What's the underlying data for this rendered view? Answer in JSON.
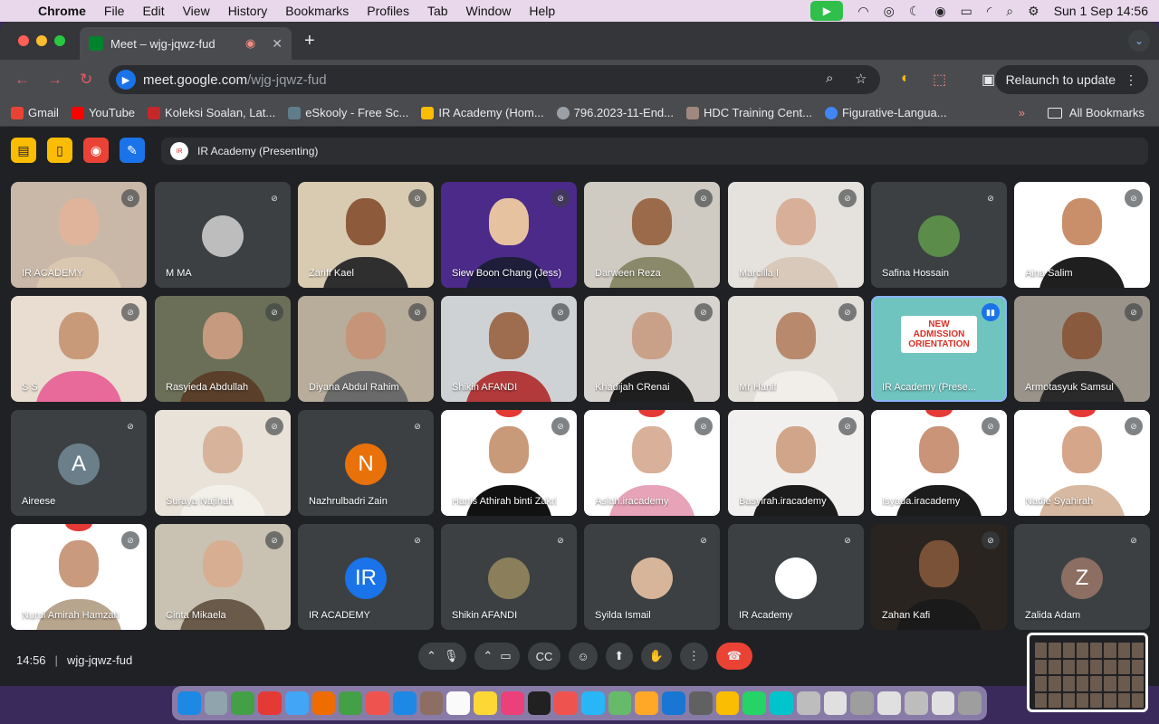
{
  "menubar": {
    "apple_glyph": "",
    "app": "Chrome",
    "items": [
      "File",
      "Edit",
      "View",
      "History",
      "Bookmarks",
      "Profiles",
      "Tab",
      "Window",
      "Help"
    ],
    "clock": "Sun 1 Sep  14:56"
  },
  "browser": {
    "tab_title": "Meet – wjg-jqwz-fud",
    "url_host": "meet.google.com",
    "url_path": "/wjg-jqwz-fud",
    "relaunch_label": "Relaunch to update",
    "bookmarks": [
      {
        "label": "Gmail",
        "color": "#ea4335"
      },
      {
        "label": "YouTube",
        "color": "#ff0000"
      },
      {
        "label": "Koleksi Soalan, Lat...",
        "color": "#c62828"
      },
      {
        "label": "eSkooly - Free Sc...",
        "color": "#607d8b"
      },
      {
        "label": "IR Academy (Hom...",
        "color": "#fbbc04"
      },
      {
        "label": "796.2023-11-End...",
        "color": "#9aa0a6"
      },
      {
        "label": "HDC Training Cent...",
        "color": "#a1887f"
      },
      {
        "label": "Figurative-Langua...",
        "color": "#4285f4"
      }
    ],
    "bookmarks_more": "»",
    "all_bookmarks": "All Bookmarks"
  },
  "meet": {
    "presenting_label": "IR Academy (Presenting)",
    "meeting_time": "14:56",
    "meeting_code": "wjg-jqwz-fud",
    "participants": [
      {
        "name": "IR ACADEMY",
        "kind": "video",
        "bg": "#c9b8a8",
        "skin": "#e0b49a",
        "cloth": "#d9c7b0"
      },
      {
        "name": "M MA",
        "kind": "avatar",
        "initial": "",
        "bg": "#3c4043",
        "avatar_color": "#bdbdbd"
      },
      {
        "name": "Zariff Kael",
        "kind": "video",
        "bg": "#d9cbb2",
        "skin": "#8d5a3b",
        "cloth": "#2f2f2f"
      },
      {
        "name": "Siew Boon Chang (Jess)",
        "kind": "video",
        "bg": "#4b2a8a",
        "skin": "#e7c2a0",
        "cloth": "#1e1e3a"
      },
      {
        "name": "Darween Reza",
        "kind": "video",
        "bg": "#cfcac2",
        "skin": "#9a6a4a",
        "cloth": "#8a8a6a"
      },
      {
        "name": "Marcilla I",
        "kind": "video",
        "bg": "#e5e2dd",
        "skin": "#d8b09a",
        "cloth": "#d9c9bb"
      },
      {
        "name": "Safina Hossain",
        "kind": "avatar",
        "initial": "",
        "bg": "#3c4043",
        "avatar_color": "#5b8c4a"
      },
      {
        "name": "Aina Salim",
        "kind": "video",
        "bg": "#ffffff",
        "skin": "#c98f6a",
        "cloth": "#1f1f1f"
      },
      {
        "name": "S S",
        "kind": "video",
        "bg": "#e8ddd0",
        "skin": "#c99a7a",
        "cloth": "#e86a9a"
      },
      {
        "name": "Rasyieda Abdullah",
        "kind": "video",
        "bg": "#6b6f58",
        "skin": "#c59a7e",
        "cloth": "#5a3f2a"
      },
      {
        "name": "Diyana Abdul Rahim",
        "kind": "video",
        "bg": "#b8ac9a",
        "skin": "#c69478",
        "cloth": "#6a6a6a"
      },
      {
        "name": "Shikin AFANDI",
        "kind": "video",
        "bg": "#cfd2d4",
        "skin": "#9e6c4e",
        "cloth": "#b23a3a"
      },
      {
        "name": "Khadijah CRenai",
        "kind": "video",
        "bg": "#d7d3cf",
        "skin": "#c9a189",
        "cloth": "#1f1f1f"
      },
      {
        "name": "Mr Hanif",
        "kind": "video",
        "bg": "#e2ded8",
        "skin": "#b8896d",
        "cloth": "#f1eeea"
      },
      {
        "name": "IR Academy (Prese...",
        "kind": "presentation",
        "bg": "#6fc4c0",
        "slide_title": "NEW ADMISSION ORIENTATION"
      },
      {
        "name": "Armotasyuk Samsul",
        "kind": "video",
        "bg": "#9a938a",
        "skin": "#8a5a3e",
        "cloth": "#2a2a2a"
      },
      {
        "name": "Aireese",
        "kind": "avatar",
        "initial": "A",
        "bg": "#3c4043",
        "avatar_color": "#6b7f8a"
      },
      {
        "name": "Suraya Najihah",
        "kind": "video",
        "bg": "#e8e2d8",
        "skin": "#d8b39c",
        "cloth": "#f3f0ea"
      },
      {
        "name": "Nazhrulbadri Zain",
        "kind": "avatar",
        "initial": "N",
        "bg": "#3c4043",
        "avatar_color": "#e8710a"
      },
      {
        "name": "Hanis Athirah binti Zakri",
        "kind": "slide-video",
        "bg": "#ffffff",
        "skin": "#c99a7a",
        "cloth": "#111111"
      },
      {
        "name": "Aslah.iracademy",
        "kind": "slide-video",
        "bg": "#ffffff",
        "skin": "#d9b09a",
        "cloth": "#e7a3b8"
      },
      {
        "name": "Basyirah.iracademy",
        "kind": "video",
        "bg": "#f2f0ee",
        "skin": "#d1a58a",
        "cloth": "#1c1c1c"
      },
      {
        "name": "Isyada.iracademy",
        "kind": "slide-video",
        "bg": "#ffffff",
        "skin": "#c99478",
        "cloth": "#1c1c1c"
      },
      {
        "name": "Nadie Syahirah",
        "kind": "slide-video",
        "bg": "#ffffff",
        "skin": "#d6a68a",
        "cloth": "#d7b8a0"
      },
      {
        "name": "Nurul Amirah Hamzah",
        "kind": "slide-video",
        "bg": "#ffffff",
        "skin": "#c99a7e",
        "cloth": "#b8a58e"
      },
      {
        "name": "Cinta Mikaela",
        "kind": "video",
        "bg": "#c9c2b2",
        "skin": "#d8ae93",
        "cloth": "#6a5a4a"
      },
      {
        "name": "IR ACADEMY",
        "kind": "avatar",
        "initial": "IR",
        "bg": "#3c4043",
        "avatar_color": "#1a73e8"
      },
      {
        "name": "Shikin AFANDI",
        "kind": "avatar",
        "initial": "",
        "bg": "#3c4043",
        "avatar_color": "#8a7f5a"
      },
      {
        "name": "Syilda Ismail",
        "kind": "avatar",
        "initial": "",
        "bg": "#3c4043",
        "avatar_color": "#d7b59a"
      },
      {
        "name": "IR Academy",
        "kind": "avatar",
        "initial": "",
        "bg": "#3c4043",
        "avatar_color": "#ffffff"
      },
      {
        "name": "Zahan Kafi",
        "kind": "video",
        "bg": "#2a2420",
        "skin": "#7a5238",
        "cloth": "#1a1a1a"
      },
      {
        "name": "Zalida Adam",
        "kind": "avatar",
        "initial": "Z",
        "bg": "#3c4043",
        "avatar_color": "#8d6e63"
      }
    ]
  },
  "colors": {
    "accent": "#1a73e8",
    "end_call": "#ea4335",
    "quick_yellow": "#fbbc04",
    "quick_red": "#ea4335",
    "quick_blue": "#1a73e8"
  }
}
